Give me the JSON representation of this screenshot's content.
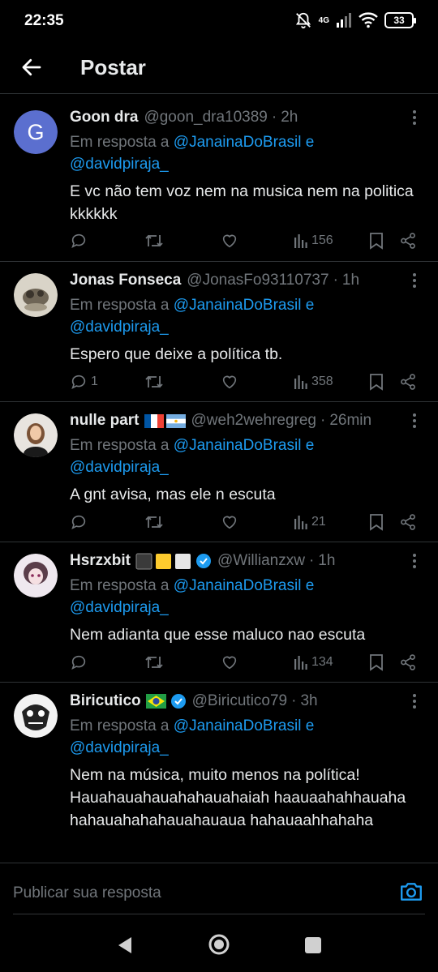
{
  "status_bar": {
    "time": "22:35",
    "network": "4G",
    "battery": "33"
  },
  "header": {
    "title": "Postar"
  },
  "reply_prefix": "Em resposta a",
  "reply_join": "e",
  "tweets": [
    {
      "name": "Goon dra",
      "handle": "@goon_dra10389",
      "time": "2h",
      "avatar_letter": "G",
      "mention1": "@JanainaDoBrasil",
      "mention2": "@davidpiraja_",
      "text": "E vc não tem voz nem na musica nem na politica kkkkkk",
      "replies": "",
      "views": "156"
    },
    {
      "name": "Jonas Fonseca",
      "handle": "@JonasFo93110737",
      "time": "1h",
      "mention1": "@JanainaDoBrasil",
      "mention2": "@davidpiraja_",
      "text": "Espero que deixe a política tb.",
      "replies": "1",
      "views": "358"
    },
    {
      "name": "nulle part",
      "handle": "@weh2wehregreg",
      "time": "26min",
      "mention1": "@JanainaDoBrasil",
      "mention2": "@davidpiraja_",
      "text": "A gnt avisa, mas ele n escuta",
      "replies": "",
      "views": "21"
    },
    {
      "name": "Hsrzxbit",
      "handle": "@Willianzxw",
      "time": "1h",
      "mention1": "@JanainaDoBrasil",
      "mention2": "@davidpiraja_",
      "text": "Nem adianta que esse maluco nao escuta",
      "replies": "",
      "views": "134"
    },
    {
      "name": "Biricutico",
      "handle": "@Biricutico79",
      "time": "3h",
      "mention1": "@JanainaDoBrasil",
      "mention2": "@davidpiraja_",
      "text": "Nem na música, muito menos na política! Hauahauahauahahauahaiah haauaahahhauaha hahauahahahauahauaua hahauaahhahaha",
      "replies": "",
      "views": ""
    }
  ],
  "reply_bar": {
    "placeholder": "Publicar sua resposta"
  },
  "colors": {
    "accent": "#1d9bf0",
    "muted": "#71767b",
    "verified": "#1d9bf0"
  },
  "icons": [
    "back-arrow-icon",
    "more-vertical-icon",
    "reply-icon",
    "retweet-icon",
    "like-icon",
    "views-icon",
    "bookmark-icon",
    "share-icon",
    "camera-icon",
    "verified-badge-icon"
  ]
}
